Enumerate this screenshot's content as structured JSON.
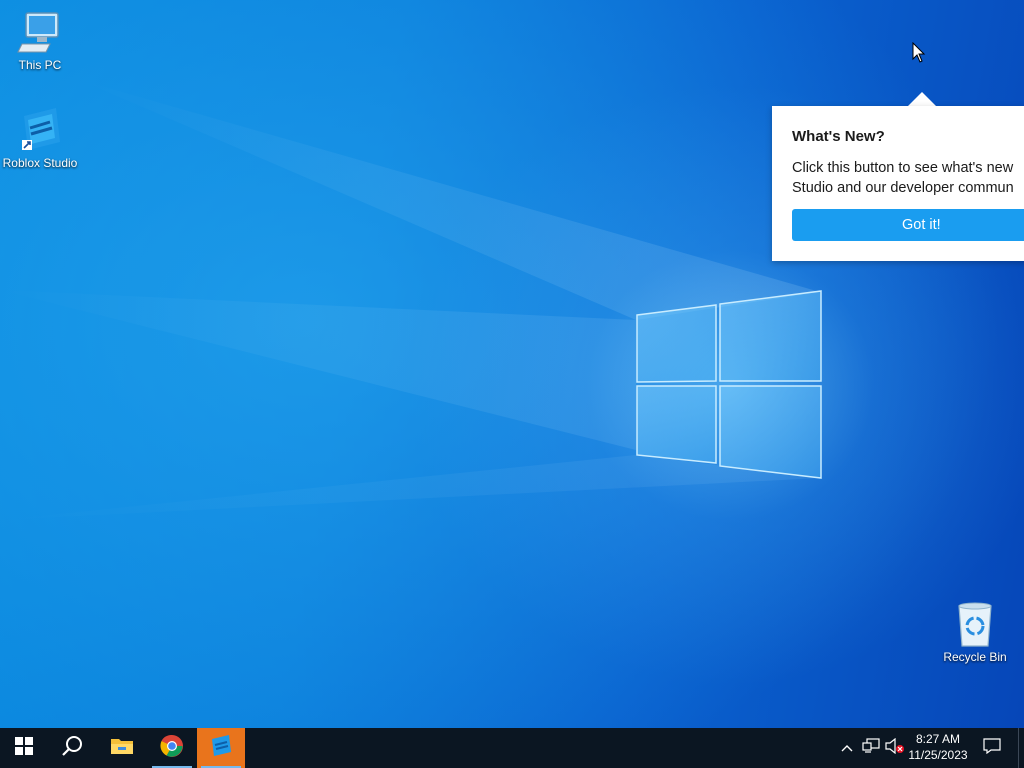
{
  "desktop": {
    "icons": [
      {
        "label": "This PC",
        "icon": "computer-icon"
      },
      {
        "label": "Roblox Studio",
        "icon": "roblox-studio-icon"
      },
      {
        "label": "Recycle Bin",
        "icon": "recycle-bin-icon"
      }
    ]
  },
  "popup": {
    "title": "What's New?",
    "body_line1": "Click this button to see what's new",
    "body_line2": "Studio and our developer commun",
    "button_label": "Got it!"
  },
  "taskbar": {
    "apps": [
      {
        "name": "Start",
        "icon": "windows-logo-icon"
      },
      {
        "name": "Search",
        "icon": "search-icon"
      },
      {
        "name": "File Explorer",
        "icon": "folder-icon"
      },
      {
        "name": "Google Chrome",
        "icon": "chrome-icon"
      },
      {
        "name": "Roblox Studio",
        "icon": "roblox-studio-icon"
      }
    ],
    "clock": {
      "time": "8:27 AM",
      "date": "11/25/2023"
    }
  },
  "colors": {
    "accent": "#1a9df0",
    "taskbar": "#0b1622",
    "roblox_active": "#e9741c"
  }
}
